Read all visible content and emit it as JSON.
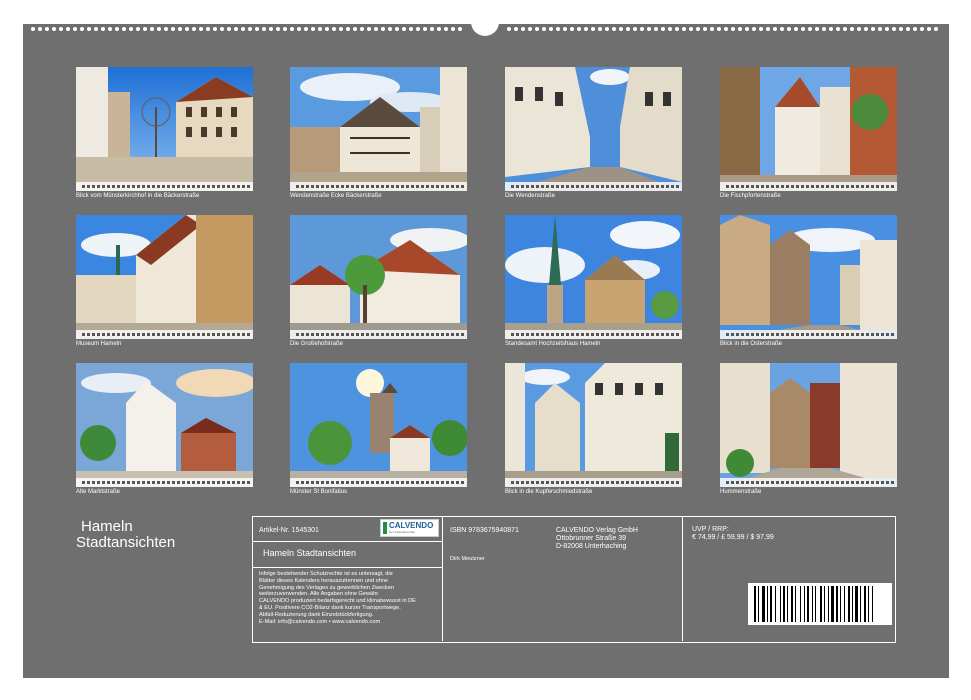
{
  "title": {
    "line1": "Hameln",
    "line2": "Stadtansichten"
  },
  "captions": [
    "Blick vom Münsterkirchhof in die Bäckerstraße",
    "Wendenstraße Ecke Bäckerstraße",
    "Die Wendenstraße",
    "Die Fischpfortenstraße",
    "Museum Hameln",
    "Die Großehofstraße",
    "Standesamt Hochzeitshaus Hameln",
    "Blick in die Osterstraße",
    "Alte Marktstraße",
    "Münster St Bonifatius",
    "Blick in die Kupferschmiedstraße",
    "Hummenstraße"
  ],
  "info": {
    "article_no": "Artikel-Nr. 1545301",
    "product_title": "Hameln Stadtansichten",
    "notice": [
      "Infolge bestehender Schutzrechte ist es untersagt, die",
      "Blätter dieses Kalenders herauszutrennen und ohne",
      "Genehmigung des Verlages zu gewerblichen Zwecken",
      "weiterzuverwenden. Alle Angaben ohne Gewähr.",
      " CALVENDO produziert bedarfsgerecht und klimabewusst in DE",
      "& EU. Positivere CO2-Bilanz dank kurzer Transportwege.",
      "Abfall-Reduzierung dank Einzelstückfertigung.",
      " E-Mail: info@calvendo.com • www.calvendo.com"
    ],
    "isbn": "ISBN 9783675940871",
    "author": "Dirk Meutzner",
    "publisher": [
      "CALVENDO Verlag GmbH",
      "Ottobrunner Straße 39",
      "D-82008 Unterhaching"
    ],
    "price_label": "UVP / RRP:",
    "price": "€ 74,99 / £ 59,99 / $ 97,99",
    "logo_text": "CALVENDO",
    "logo_sub": "Der Kalenderverlag"
  }
}
